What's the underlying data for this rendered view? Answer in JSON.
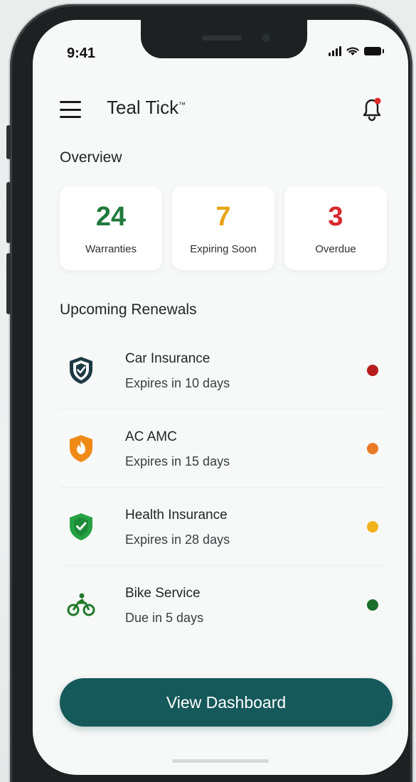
{
  "status_bar": {
    "time": "9:41"
  },
  "header": {
    "title": "Teal Tick",
    "trademark": "™"
  },
  "overview": {
    "title": "Overview",
    "cards": [
      {
        "value": "24",
        "label": "Warranties",
        "color": "#1f7a3a"
      },
      {
        "value": "7",
        "label": "Expiring Soon",
        "color": "#e8a316"
      },
      {
        "value": "3",
        "label": "Overdue",
        "color": "#d9282f"
      }
    ]
  },
  "renewals": {
    "title": "Upcoming Renewals",
    "items": [
      {
        "name": "Car Insurance",
        "sub": "Expires in 10 days",
        "icon": "shield-check-icon",
        "icon_color": "#1d3a44",
        "status_color": "#b71c1c"
      },
      {
        "name": "AC AMC",
        "sub": "Expires in 15 days",
        "icon": "shield-flame-icon",
        "icon_color": "#ef8a17",
        "status_color": "#ea7a25"
      },
      {
        "name": "Health Insurance",
        "sub": "Expires in 28 days",
        "icon": "shield-check-icon",
        "icon_color": "#25a244",
        "status_color": "#f2b21c"
      },
      {
        "name": "Bike Service",
        "sub": "Due in 5 days",
        "icon": "motorbike-icon",
        "icon_color": "#1f7a2a",
        "status_color": "#1b6e2a"
      }
    ]
  },
  "cta": {
    "label": "View Dashboard",
    "color": "#16595a"
  },
  "accent": {
    "notification_dot": "#e02a2a"
  }
}
